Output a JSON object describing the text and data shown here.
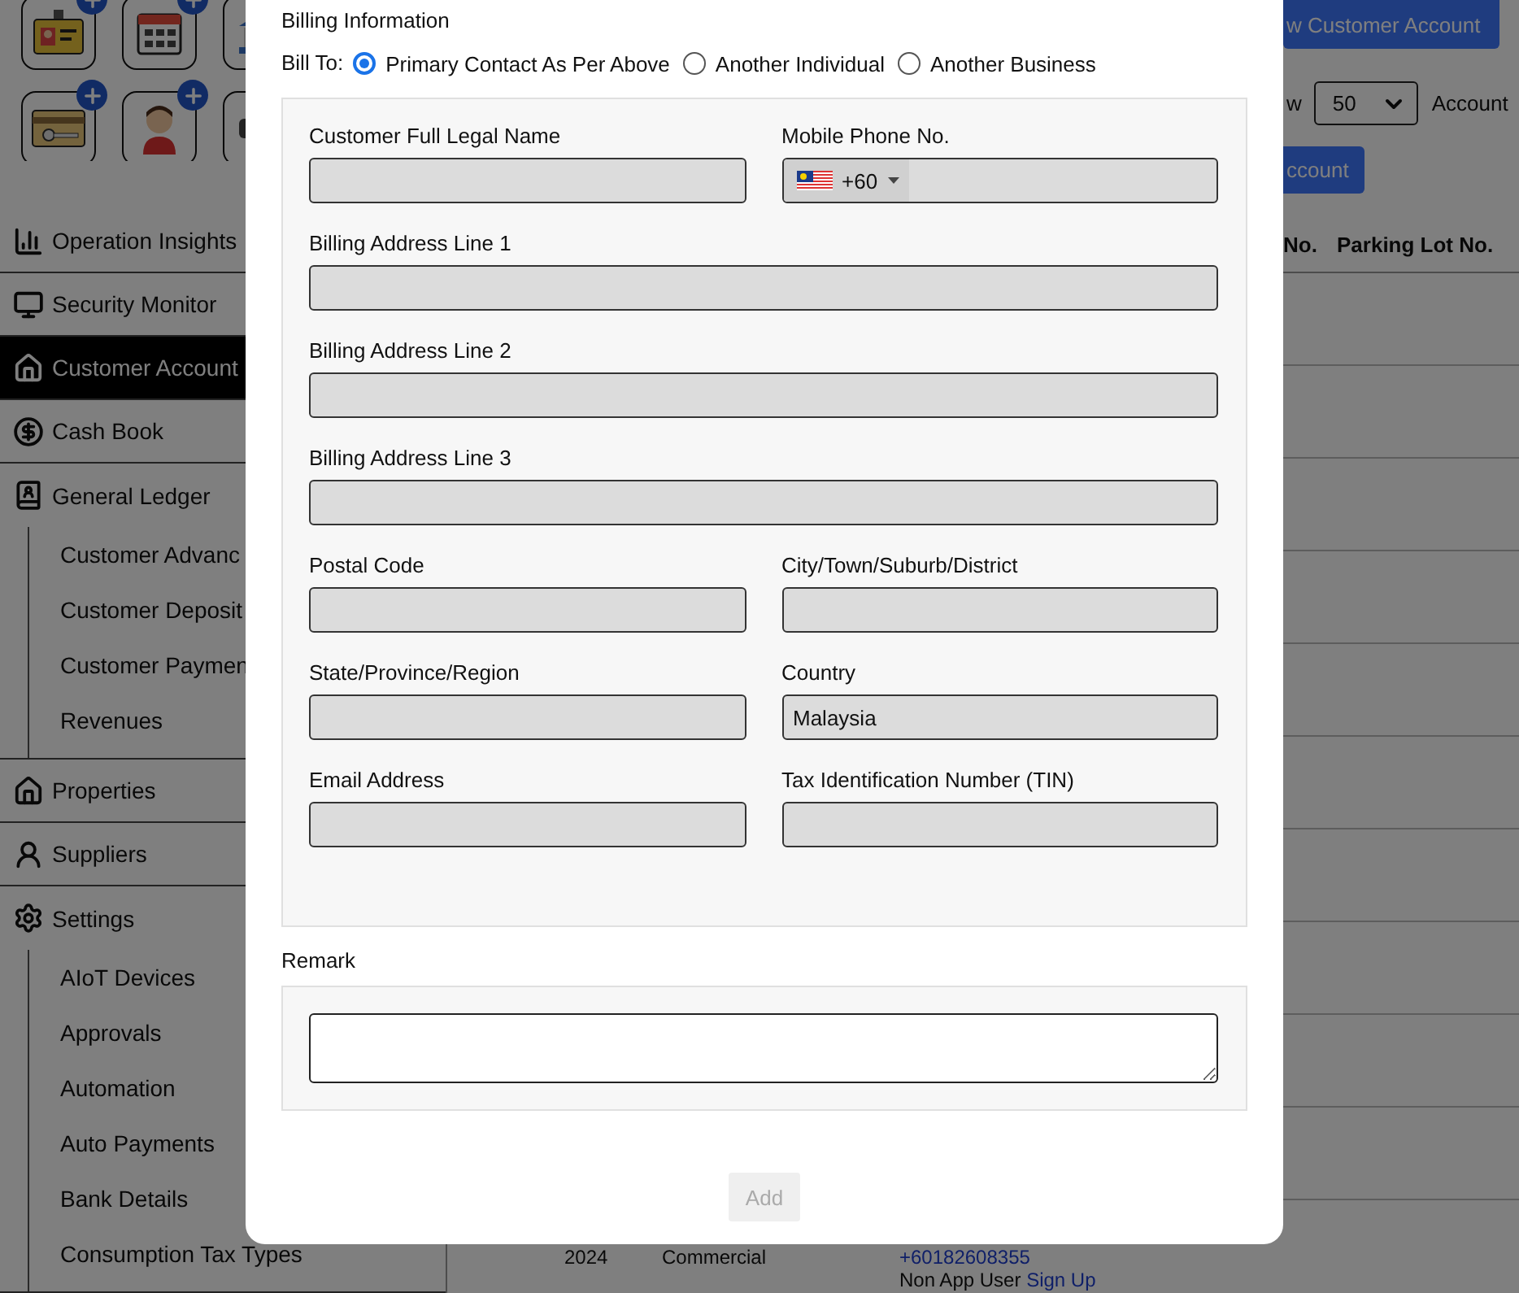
{
  "sidebar": {
    "items": [
      {
        "label": "Operation Insights",
        "selected": false
      },
      {
        "label": "Security Monitor",
        "selected": false
      },
      {
        "label": "Customer Account",
        "selected": true
      },
      {
        "label": "Cash Book",
        "selected": false
      },
      {
        "label": "General Ledger",
        "selected": false,
        "children": [
          {
            "label": "Customer Advanc",
            "selected": false
          },
          {
            "label": "Customer Deposit",
            "selected": false
          },
          {
            "label": "Customer Paymen",
            "selected": false
          },
          {
            "label": "Revenues",
            "selected": false
          }
        ]
      },
      {
        "label": "Properties",
        "selected": false
      },
      {
        "label": "Suppliers",
        "selected": false
      },
      {
        "label": "Settings",
        "selected": false,
        "children": [
          {
            "label": "AIoT Devices",
            "selected": false
          },
          {
            "label": "Approvals",
            "selected": false
          },
          {
            "label": "Automation",
            "selected": false
          },
          {
            "label": "Auto Payments",
            "selected": false
          },
          {
            "label": "Bank Details",
            "selected": false
          },
          {
            "label": "Consumption Tax Types",
            "selected": false
          }
        ]
      }
    ]
  },
  "header": {
    "new_button": "w Customer Account",
    "show_label": "w",
    "page_size": "50",
    "page_size_suffix": "Account",
    "action_button": "ccount"
  },
  "table": {
    "columns": [
      "No.",
      "Parking Lot No."
    ],
    "rows": [
      {
        "cell_1": "2024",
        "cell_2": "Commercial",
        "contact": {
          "phone": "+60182608355",
          "status": "Non App User",
          "link": "Sign Up"
        }
      }
    ]
  },
  "modal": {
    "section_title": "Billing Information",
    "bill_to": {
      "label": "Bill To:",
      "options": [
        {
          "label": "Primary Contact As Per Above",
          "selected": true
        },
        {
          "label": "Another Individual",
          "selected": false
        },
        {
          "label": "Another Business",
          "selected": false
        }
      ]
    },
    "rows": [
      [
        {
          "label": "Customer Full Legal Name",
          "kind": "text"
        },
        {
          "label": "Mobile Phone No.",
          "kind": "phone",
          "dial_code": "+60"
        }
      ],
      [
        {
          "label": "Billing Address Line 1",
          "kind": "text"
        }
      ],
      [
        {
          "label": "Billing Address Line 2",
          "kind": "text"
        }
      ],
      [
        {
          "label": "Billing Address Line 3",
          "kind": "text"
        }
      ],
      [
        {
          "label": "Postal Code",
          "kind": "text"
        },
        {
          "label": "City/Town/Suburb/District",
          "kind": "text"
        }
      ],
      [
        {
          "label": "State/Province/Region",
          "kind": "text"
        },
        {
          "label": "Country",
          "kind": "text",
          "value": "Malaysia"
        }
      ],
      [
        {
          "label": "Email Address",
          "kind": "text"
        },
        {
          "label": "Tax Identification Number (TIN)",
          "kind": "text"
        }
      ]
    ],
    "remark": {
      "label": "Remark"
    },
    "add_button": {
      "label": "Add",
      "disabled": true
    }
  }
}
